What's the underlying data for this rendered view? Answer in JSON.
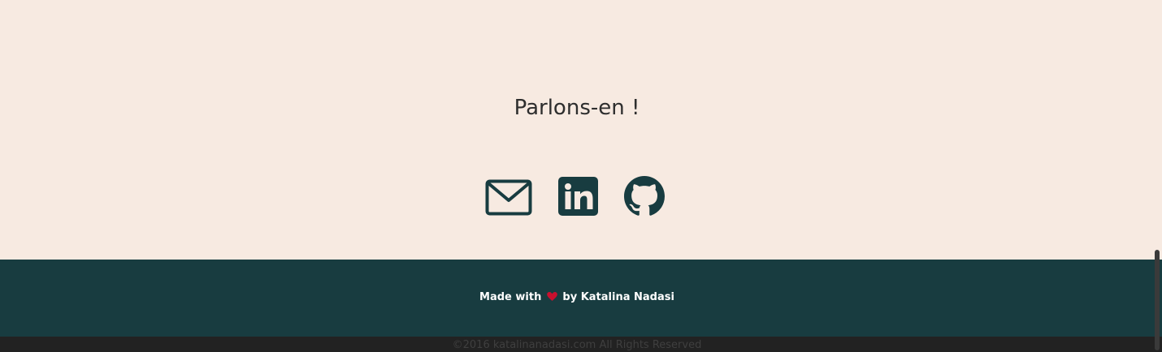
{
  "contact": {
    "title": "Parlons-en !",
    "icons": [
      {
        "name": "email-icon",
        "label": "Email"
      },
      {
        "name": "linkedin-icon",
        "label": "LinkedIn"
      },
      {
        "name": "github-icon",
        "label": "GitHub"
      }
    ]
  },
  "footer": {
    "made_with": "Made with",
    "heart_icon": "heart-icon",
    "by_author": "by Katalina Nadasi",
    "copyright": "©2016 katalinanadasi.com All Rights Reserved"
  },
  "colors": {
    "background": "#f7eae1",
    "icon": "#183c40",
    "footer": "#183c40",
    "heart": "#c8102e",
    "copyright_bar": "#222222"
  }
}
